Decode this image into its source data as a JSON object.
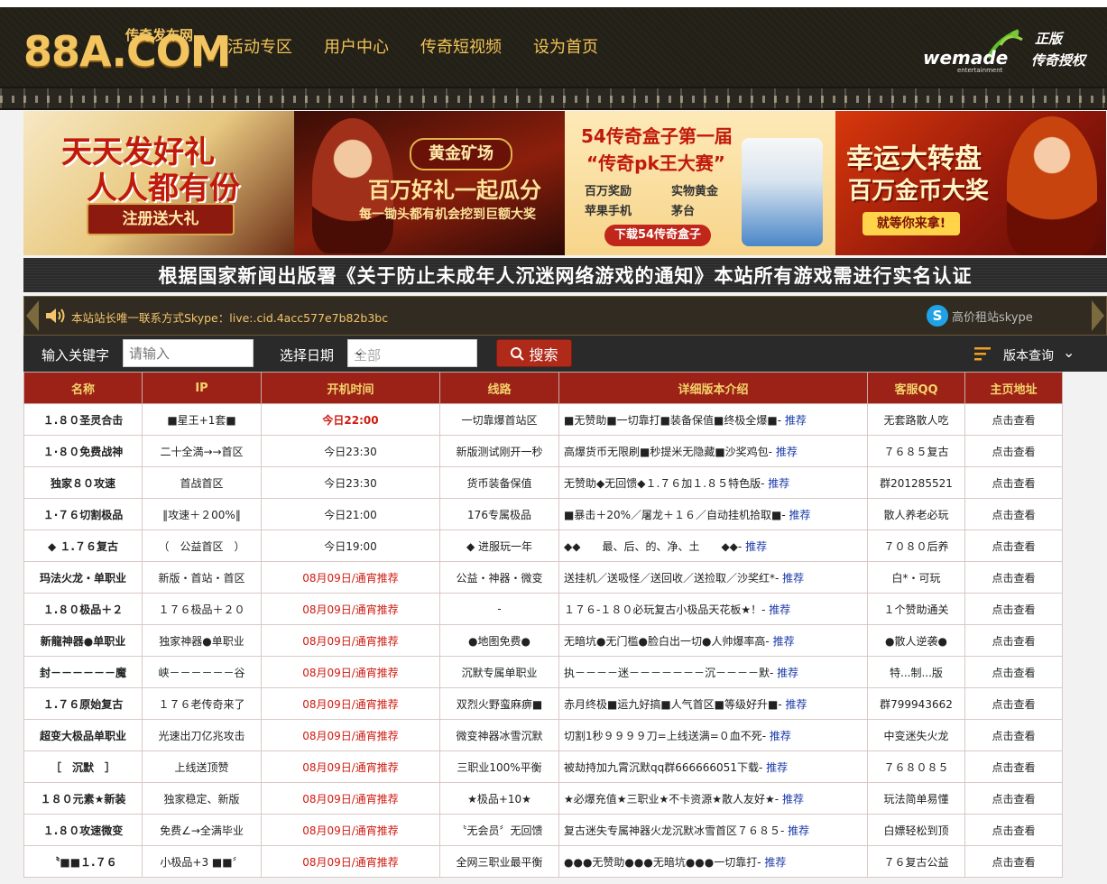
{
  "header": {
    "logo_text": "88A.COM",
    "logo_sub": "传奇发布网",
    "nav": [
      "活动专区",
      "用户中心",
      "传奇短视频",
      "设为首页"
    ],
    "partner_brand": "wemade",
    "partner_brand_small": "entertainment",
    "partner_line1": "正版",
    "partner_line2": "传奇授权"
  },
  "banners": [
    {
      "line1": "天天发好礼",
      "line2": "人人都有份",
      "button": "注册送大礼"
    },
    {
      "badge": "黄金矿场",
      "line1": "百万好礼一起瓜分",
      "line2": "每一锄头都有机会挖到巨额大奖"
    },
    {
      "line1": "54传奇盒子第一届",
      "line2": "“传奇pk王大赛”",
      "items": [
        "百万奖励",
        "实物黄金",
        "苹果手机",
        "茅台"
      ],
      "button": "下载54传奇盒子"
    },
    {
      "line1": "幸运大转盘",
      "line2": "百万金币大奖",
      "button": "就等你来拿!"
    }
  ],
  "notice": "根据国家新闻出版署《关于防止未成年人沉迷网络游戏的通知》本站所有游戏需进行实名认证",
  "announce": {
    "message": "本站站长唯一联系方式Skype：live:.cid.4acc577e7b82b3bc",
    "skype_label": "高价租站skype"
  },
  "search": {
    "keyword_label": "输入关键字",
    "keyword_placeholder": "请输入",
    "date_label": "选择日期",
    "date_value": "全部",
    "button": "搜索",
    "version_query": "版本查询"
  },
  "table": {
    "headers": [
      "名称",
      "IP",
      "开机时间",
      "线路",
      "详细版本介绍",
      "客服QQ",
      "主页地址"
    ],
    "rows": [
      {
        "name": "１.８０圣灵合击",
        "ip": "■星王+1套■",
        "time": "今日22:00",
        "line": "一切靠爆首站区",
        "intro": "■无赞助■一切靠打■装备保值■终极全爆■-",
        "qq": "无套路散人吃",
        "link": "点击查看"
      },
      {
        "name": "１·８０免费战神",
        "ip": "二十全満→→首区",
        "time": "今日23:30",
        "line": "新版测试刚开一秒",
        "intro": "高爆货币无限刷■秒提米无隐藏■沙奖鸡包-",
        "qq": "７６８５复古",
        "link": "点击查看"
      },
      {
        "name": "独家８０攻速",
        "ip": "首战首区",
        "time": "今日23:30",
        "line": "货币装备保值",
        "intro": "无赞助◆无回馈◆１.７６加１.８５特色版-",
        "qq": "群201285521",
        "link": "点击查看"
      },
      {
        "name": "１·７６切割极品",
        "ip": "‖攻速＋２00%‖",
        "time": "今日21:00",
        "line": "176专属极品",
        "intro": "■暴击＋20%／屠龙＋１６／自动挂机拾取■-",
        "qq": "散人养老必玩",
        "link": "点击查看"
      },
      {
        "name": "◆ １.７６复古",
        "ip": "（　公益首区　）",
        "time": "今日19:00",
        "line": "◆ 进服玩一年",
        "intro": "◆◆　　最、后、的、净、土　　◆◆-",
        "qq": "７０８０后养",
        "link": "点击查看"
      },
      {
        "name": "玛法火龙・单职业",
        "ip": "新版・首站・首区",
        "time": "08月09日/通宵推荐",
        "line": "公益・神器・微变",
        "intro": "送挂机／送吸怪／送回收／送捡取／沙奖红*-",
        "qq": "白*・可玩",
        "link": "点击查看"
      },
      {
        "name": "１.８０极品＋２",
        "ip": "１７６极品＋２０",
        "time": "08月09日/通宵推荐",
        "line": "-",
        "intro": "１７６-１８０必玩复古小极品天花板★！-",
        "qq": "１个赞助通关",
        "link": "点击查看"
      },
      {
        "name": "新龍神器●单职业",
        "ip": "独家神器●单职业",
        "time": "08月09日/通宵推荐",
        "line": "●地图免费●",
        "intro": "无暗坑●无门槛●脸白出一切●人帅爆率高-",
        "qq": "●散人逆袭●",
        "link": "点击查看"
      },
      {
        "name": "封－－－－－－魔",
        "ip": "峡－－－－－－谷",
        "time": "08月09日/通宵推荐",
        "line": "沉默专属单职业",
        "intro": "执－－－－迷－－－－－－－沉－－－－默-",
        "qq": "特...制...版",
        "link": "点击查看"
      },
      {
        "name": "１.７６原始复古",
        "ip": "１７６老传奇来了",
        "time": "08月09日/通宵推荐",
        "line": "双烈火野蛮麻痹■",
        "intro": "赤月终极■运九好搞■人气首区■等级好升■-",
        "qq": "群799943662",
        "link": "点击查看"
      },
      {
        "name": "超变大极品单职业",
        "ip": "光速出刀亿兆攻击",
        "time": "08月09日/通宵推荐",
        "line": "微变神器冰雪沉默",
        "intro": "切割1秒９９９９刀=上线送满=０血不死-",
        "qq": "中变迷失火龙",
        "link": "点击查看"
      },
      {
        "name": "［　沉默　］",
        "ip": "上线送顶赞",
        "time": "08月09日/通宵推荐",
        "line": "三职业100%平衡",
        "intro": "被劫持加九霄沉默qq群666666051下载-",
        "qq": "７６８０８５",
        "link": "点击查看"
      },
      {
        "name": "１８０元素★新装",
        "ip": "独家稳定、新版",
        "time": "08月09日/通宵推荐",
        "line": "★极品+10★",
        "intro": "★必爆充值★三职业★不卡资源★散人友好★-",
        "qq": "玩法简单易懂",
        "link": "点击查看"
      },
      {
        "name": "１.８０攻速微变",
        "ip": "免费∠→全满毕业",
        "time": "08月09日/通宵推荐",
        "line": "〝无会员〞无回馈",
        "intro": "复古迷失专属神器火龙沉默冰雪首区７６８５-",
        "qq": "白嫖轻松到顶",
        "link": "点击查看"
      },
      {
        "name": "〝■■１.７６",
        "ip": "小极品+3 ■■〞",
        "time": "08月09日/通宵推荐",
        "line": "全网三职业最平衡",
        "intro": "●●●无赞助●●●无暗坑●●●一切靠打-",
        "qq": "７６复古公益",
        "link": "点击查看"
      }
    ],
    "recommend": "推荐"
  },
  "colors": {
    "header_bg": "#232018",
    "nav_gold": "#f1c353",
    "table_header_bg": "#9c2218",
    "table_header_text": "#f4d36b",
    "hot_red": "#cf1a10",
    "link_blue": "#1a3aa8"
  }
}
